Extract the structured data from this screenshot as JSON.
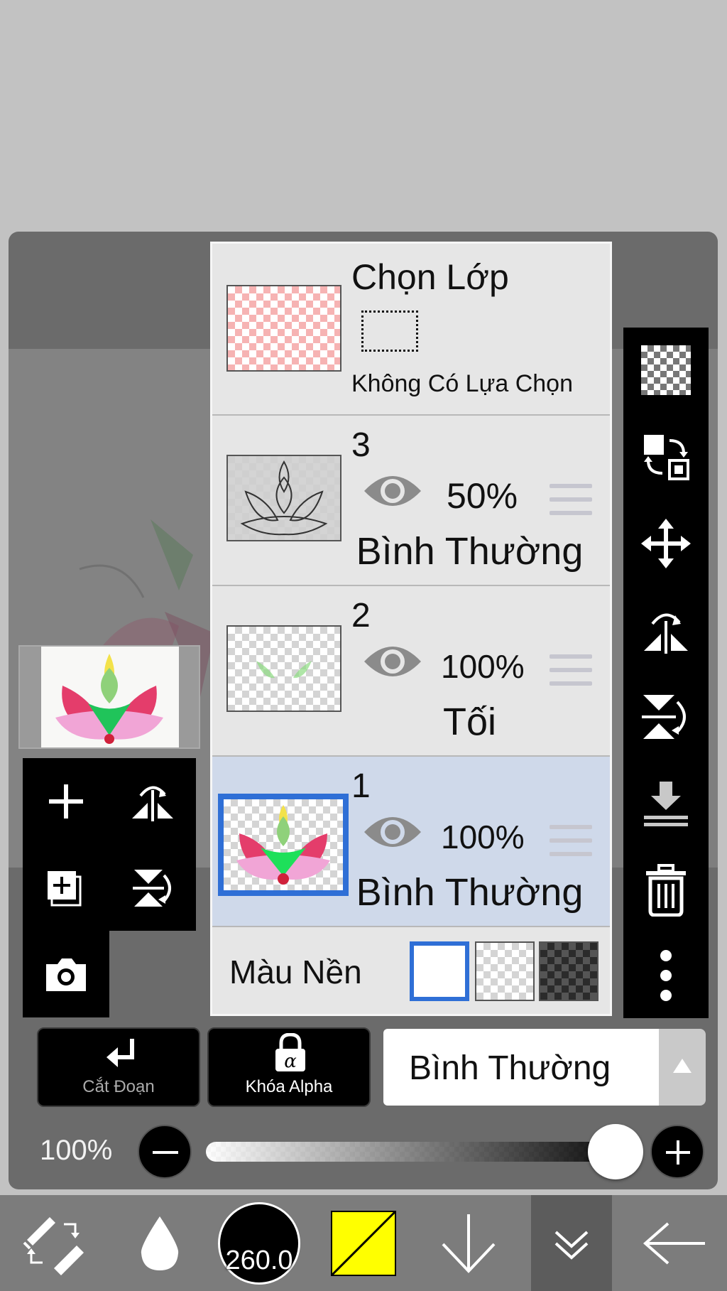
{
  "selection_layer": {
    "title": "Chọn Lớp",
    "subtitle": "Không Có Lựa Chọn"
  },
  "layers": [
    {
      "number": "3",
      "opacity": "50%",
      "blend": "Bình Thường",
      "visible": true,
      "selected": false
    },
    {
      "number": "2",
      "opacity": "100%",
      "blend": "Tối",
      "visible": true,
      "selected": false
    },
    {
      "number": "1",
      "opacity": "100%",
      "blend": "Bình Thường",
      "visible": true,
      "selected": true
    }
  ],
  "background": {
    "label": "Màu Nền",
    "options": [
      "white",
      "transparent",
      "dark-checker"
    ],
    "selected": "white"
  },
  "right_toolbar": [
    "checker-icon",
    "swap-layer-icon",
    "move-icon",
    "flip-horizontal-icon",
    "flip-vertical-icon",
    "merge-down-icon",
    "trash-icon",
    "more-icon"
  ],
  "left_toolbar": [
    "add-layer-icon",
    "flip-h-icon",
    "add-copy-layer-icon",
    "flip-v-icon",
    "camera-icon"
  ],
  "controls": {
    "clip_label": "Cắt Đoạn",
    "alpha_lock_label": "Khóa Alpha",
    "blend_mode": "Bình Thường",
    "opacity": "100%",
    "opacity_value": 1.0
  },
  "bottom_bar": {
    "brush_size": "260.0",
    "color": "#ffff00",
    "selected_accent": "#2f6fd6"
  }
}
